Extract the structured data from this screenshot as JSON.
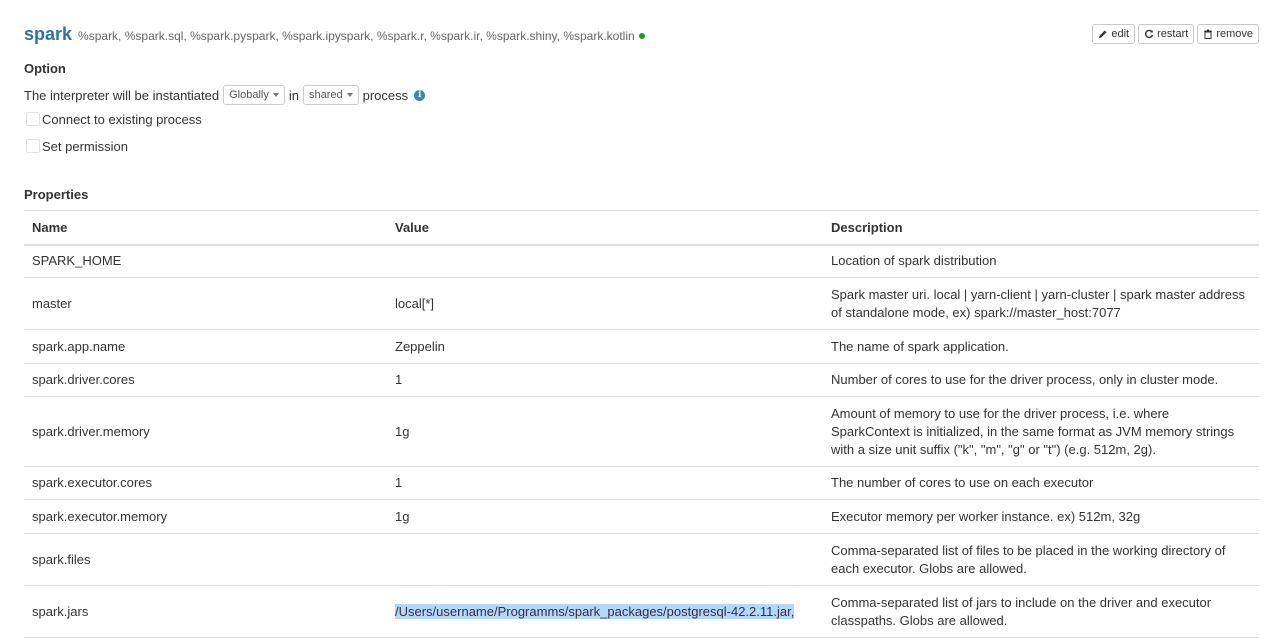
{
  "interpreter": {
    "name": "spark",
    "aliases": "%spark, %spark.sql, %spark.pyspark, %spark.ipyspark, %spark.r, %spark.ir, %spark.shiny, %spark.kotlin",
    "status_color": "#17a217"
  },
  "actions": {
    "edit": "edit",
    "restart": "restart",
    "remove": "remove"
  },
  "option": {
    "title": "Option",
    "instantiate_prefix": "The interpreter will be instantiated",
    "scope_value": "Globally",
    "in_text": "in",
    "process_value": "shared",
    "process_text": "process",
    "connect_label": "Connect to existing process",
    "permission_label": "Set permission"
  },
  "properties": {
    "title": "Properties",
    "headers": {
      "name": "Name",
      "value": "Value",
      "description": "Description"
    },
    "rows": [
      {
        "name": "SPARK_HOME",
        "value": "",
        "description": "Location of spark distribution"
      },
      {
        "name": "master",
        "value": "local[*]",
        "description": "Spark master uri. local | yarn-client | yarn-cluster | spark master address of standalone mode, ex) spark://master_host:7077"
      },
      {
        "name": "spark.app.name",
        "value": "Zeppelin",
        "description": "The name of spark application."
      },
      {
        "name": "spark.driver.cores",
        "value": "1",
        "description": "Number of cores to use for the driver process, only in cluster mode."
      },
      {
        "name": "spark.driver.memory",
        "value": "1g",
        "description": "Amount of memory to use for the driver process, i.e. where SparkContext is initialized, in the same format as JVM memory strings with a size unit suffix (\"k\", \"m\", \"g\" or \"t\") (e.g. 512m, 2g)."
      },
      {
        "name": "spark.executor.cores",
        "value": "1",
        "description": "The number of cores to use on each executor"
      },
      {
        "name": "spark.executor.memory",
        "value": "1g",
        "description": "Executor memory per worker instance. ex) 512m, 32g"
      },
      {
        "name": "spark.files",
        "value": "",
        "description": "Comma-separated list of files to be placed in the working directory of each executor. Globs are allowed."
      },
      {
        "name": "spark.jars",
        "value": "/Users/username/Programms/spark_packages/postgresql-42.2.11.jar,",
        "description": "Comma-separated list of jars to include on the driver and executor classpaths. Globs are allowed."
      }
    ]
  }
}
